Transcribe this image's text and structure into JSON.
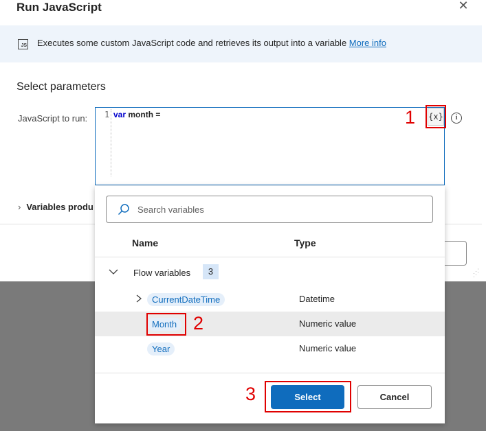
{
  "dialog": {
    "title": "Run JavaScript",
    "close_glyph": "✕",
    "info": {
      "icon_text": "JS",
      "text": "Executes some custom JavaScript code and retrieves its output into a variable",
      "link": "More info"
    },
    "section_title": "Select parameters",
    "javascript_field": {
      "label": "JavaScript to run:",
      "line_number": "1",
      "keyword": "var",
      "code_rest": " month ="
    },
    "var_button_label": "{x}",
    "help_glyph": "i",
    "variables_produced_label": "Variables produ"
  },
  "variable_picker": {
    "search_placeholder": "Search variables",
    "columns": {
      "name": "Name",
      "type": "Type"
    },
    "group": {
      "label": "Flow variables",
      "count": "3"
    },
    "rows": [
      {
        "name": "CurrentDateTime",
        "type": "Datetime",
        "expandable": true,
        "selected": false
      },
      {
        "name": "Month",
        "type": "Numeric value",
        "expandable": false,
        "selected": true
      },
      {
        "name": "Year",
        "type": "Numeric value",
        "expandable": false,
        "selected": false
      }
    ],
    "select_label": "Select",
    "cancel_label": "Cancel"
  },
  "callouts": [
    "1",
    "2",
    "3"
  ],
  "colors": {
    "accent": "#0f6cbd",
    "callout_red": "#e00000",
    "info_bar": "#eef4fb",
    "chip_bg": "#e5effa",
    "backdrop": "#7a7a7a"
  }
}
